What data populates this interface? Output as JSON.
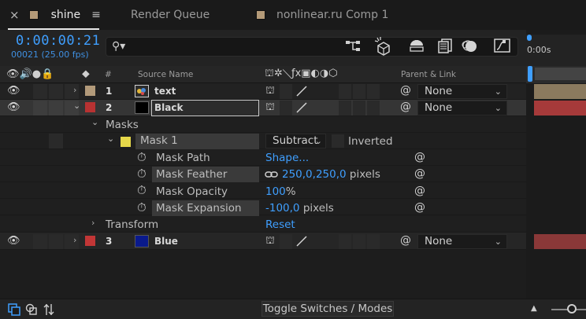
{
  "tabs": {
    "close": "×",
    "active": "shine",
    "menu": "≡",
    "render_queue": "Render Queue",
    "comp": "nonlinear.ru Comp 1"
  },
  "header": {
    "timecode": "0:00:00:21",
    "frame_fps": "00021 (25.00 fps)",
    "search_placeholder": "",
    "ruler_label": "0:00s"
  },
  "columns": {
    "hash": "#",
    "source_name": "Source Name",
    "parent_link": "Parent & Link"
  },
  "layers": [
    {
      "num": "1",
      "name": "text",
      "parent": "None"
    },
    {
      "num": "2",
      "name": "Black",
      "parent": "None"
    },
    {
      "num": "3",
      "name": "Blue",
      "parent": "None"
    }
  ],
  "masks_group": "Masks",
  "mask": {
    "name": "Mask 1",
    "mode": "Subtract",
    "inverted": "Inverted"
  },
  "mask_props": [
    {
      "label": "Mask Path",
      "value": "Shape...",
      "unit": ""
    },
    {
      "label": "Mask Feather",
      "value": "250,0,250,0",
      "unit": " pixels"
    },
    {
      "label": "Mask Opacity",
      "value": "100",
      "unit": "%"
    },
    {
      "label": "Mask Expansion",
      "value": "-100,0",
      "unit": " pixels"
    }
  ],
  "transform": {
    "label": "Transform",
    "value": "Reset"
  },
  "footer": {
    "toggle": "Toggle Switches / Modes"
  },
  "colors": {
    "accent": "#3f9fff",
    "layer1_label": "#b29a7a",
    "layer2_label": "#b83232",
    "layer3_label": "#c23636",
    "mask_color": "#e6d84a",
    "blue_solid": "#0a1a8c",
    "bar_text": "#8b7a5e",
    "bar_black": "#a63a3a",
    "bar_blue": "#8a3838"
  },
  "icons": {
    "eye": "eye-icon",
    "stopwatch": "stopwatch-icon",
    "pickwhip": "pickwhip-icon",
    "link": "link-icon"
  }
}
